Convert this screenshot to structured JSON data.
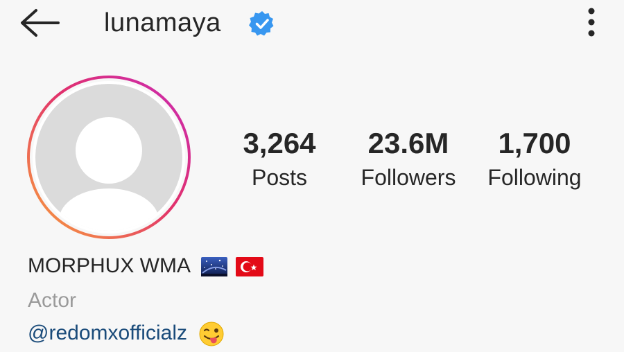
{
  "header": {
    "username": "lunamaya",
    "back_icon": "arrow-left-icon",
    "verified_icon": "verified-badge-icon",
    "menu_icon": "more-vertical-icon"
  },
  "stats": {
    "posts": {
      "value": "3,264",
      "label": "Posts"
    },
    "followers": {
      "value": "23.6M",
      "label": "Followers"
    },
    "following": {
      "value": "1,700",
      "label": "Following"
    }
  },
  "profile": {
    "display_name": "MORPHUX WMA",
    "name_emojis": [
      "night-sky-flag-icon",
      "turkey-flag-icon"
    ],
    "category": "Actor",
    "bio_mention": "@redomxofficialz",
    "bio_emoji": "winking-tongue-face-icon"
  },
  "colors": {
    "verified_blue": "#3897f0",
    "story_ring_start": "#f9a23b",
    "story_ring_end": "#c92bb7",
    "mention_blue": "#1a4b7a",
    "muted_text": "#9a9a9a"
  }
}
